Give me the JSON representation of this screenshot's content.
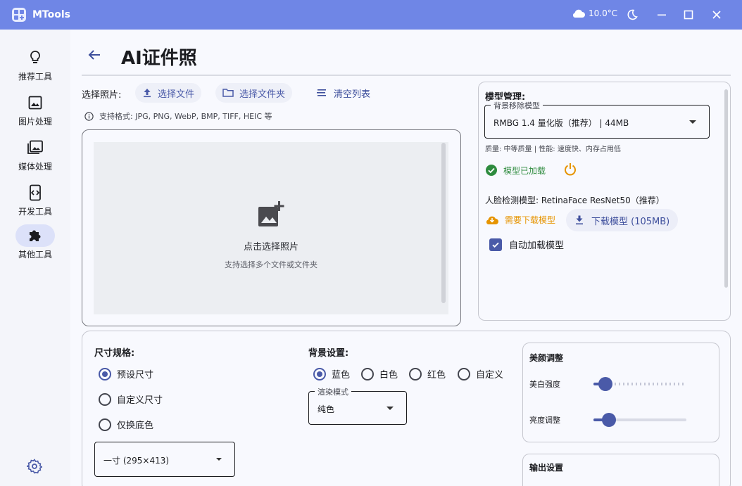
{
  "titlebar": {
    "app_name": "MTools",
    "weather": "10.0°C"
  },
  "sidebar": {
    "items": [
      {
        "label": "推荐工具",
        "icon": "lightbulb-icon"
      },
      {
        "label": "图片处理",
        "icon": "image-icon"
      },
      {
        "label": "媒体处理",
        "icon": "photo-library-icon"
      },
      {
        "label": "开发工具",
        "icon": "code-icon"
      },
      {
        "label": "其他工具",
        "icon": "puzzle-icon",
        "active": true
      }
    ],
    "settings_icon": "gear-icon"
  },
  "page": {
    "title": "AI证件照"
  },
  "file_select": {
    "label": "选择照片:",
    "select_file": "选择文件",
    "select_folder": "选择文件夹",
    "clear_list": "清空列表",
    "formats": "支持格式: JPG, PNG, WebP, BMP, TIFF, HEIC 等"
  },
  "drop_zone": {
    "main_text": "点击选择照片",
    "sub_text": "支持选择多个文件或文件夹"
  },
  "model_panel": {
    "title": "模型管理:",
    "bg_model_label": "背景移除模型",
    "bg_model_value": "RMBG 1.4 量化版（推荐） | 44MB",
    "quality": "质量: 中等质量 | 性能: 速度快、内存占用低",
    "status": "模型已加载",
    "face_model": "人脸检测模型: RetinaFace ResNet50（推荐）",
    "need_download": "需要下载模型",
    "download_button": "下载模型 (105MB)",
    "auto_load": "自动加载模型",
    "auto_load_checked": true
  },
  "size": {
    "title": "尺寸规格:",
    "options": [
      "预设尺寸",
      "自定义尺寸",
      "仅换底色"
    ],
    "selected": 0,
    "preset_value": "一寸 (295×413)"
  },
  "background": {
    "title": "背景设置:",
    "options": [
      "蓝色",
      "白色",
      "红色",
      "自定义"
    ],
    "selected": 0,
    "render_label": "渲染模式",
    "render_value": "纯色"
  },
  "beauty": {
    "title": "美颜调整",
    "whitening_label": "美白强度",
    "whitening_level": 0.13,
    "brightness_label": "亮度调整",
    "brightness_level": 0.17
  },
  "output": {
    "title": "输出设置"
  },
  "colors": {
    "titlebar": "#6f86e6",
    "accent": "#4a5aa8",
    "success": "#2e8b3e",
    "warning": "#e69400"
  }
}
